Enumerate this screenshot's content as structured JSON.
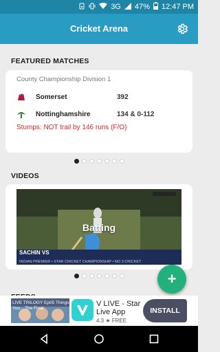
{
  "status_bar": {
    "battery": "47%",
    "time": "12:47 PM",
    "network": "3G"
  },
  "app": {
    "title": "Cricket Arena"
  },
  "featured": {
    "heading": "FEATURED MATCHES",
    "match": {
      "competition": "County Championship Division 1",
      "teams": [
        {
          "name": "Somerset",
          "score": "392",
          "flag_color": "#b0193a"
        },
        {
          "name": "Nottinghamshire",
          "score": "134 & 0-112",
          "flag_color": "#2e7d32"
        }
      ],
      "status": "Stumps: NOT trail by 146 runs (F/O)"
    },
    "carousel": {
      "count": 7,
      "active": 0
    }
  },
  "videos": {
    "heading": "VIDEOS",
    "item": {
      "label": "Batting",
      "overlay_name": "SACHIN VS",
      "overlay_sub": "INDIAN PREMIER • STAR CRICKET CHAMPIONSHIP • NO 3 CRICKET"
    },
    "carousel": {
      "count": 7,
      "active": 0
    }
  },
  "feeds": {
    "heading": "FEEDS"
  },
  "fab": {
    "label": "+"
  },
  "ad": {
    "image_caption": "LIVE TRILOGY Ep05 Things You... The Final",
    "app_name": "V LIVE - Star Live App",
    "rating": "4.3 ★ FREE",
    "install_label": "INSTALL"
  },
  "colors": {
    "status_bar": "#1f85a6",
    "app_bar": "#2a9bc2",
    "fab": "#22b07d",
    "status_text": "#e02424"
  }
}
